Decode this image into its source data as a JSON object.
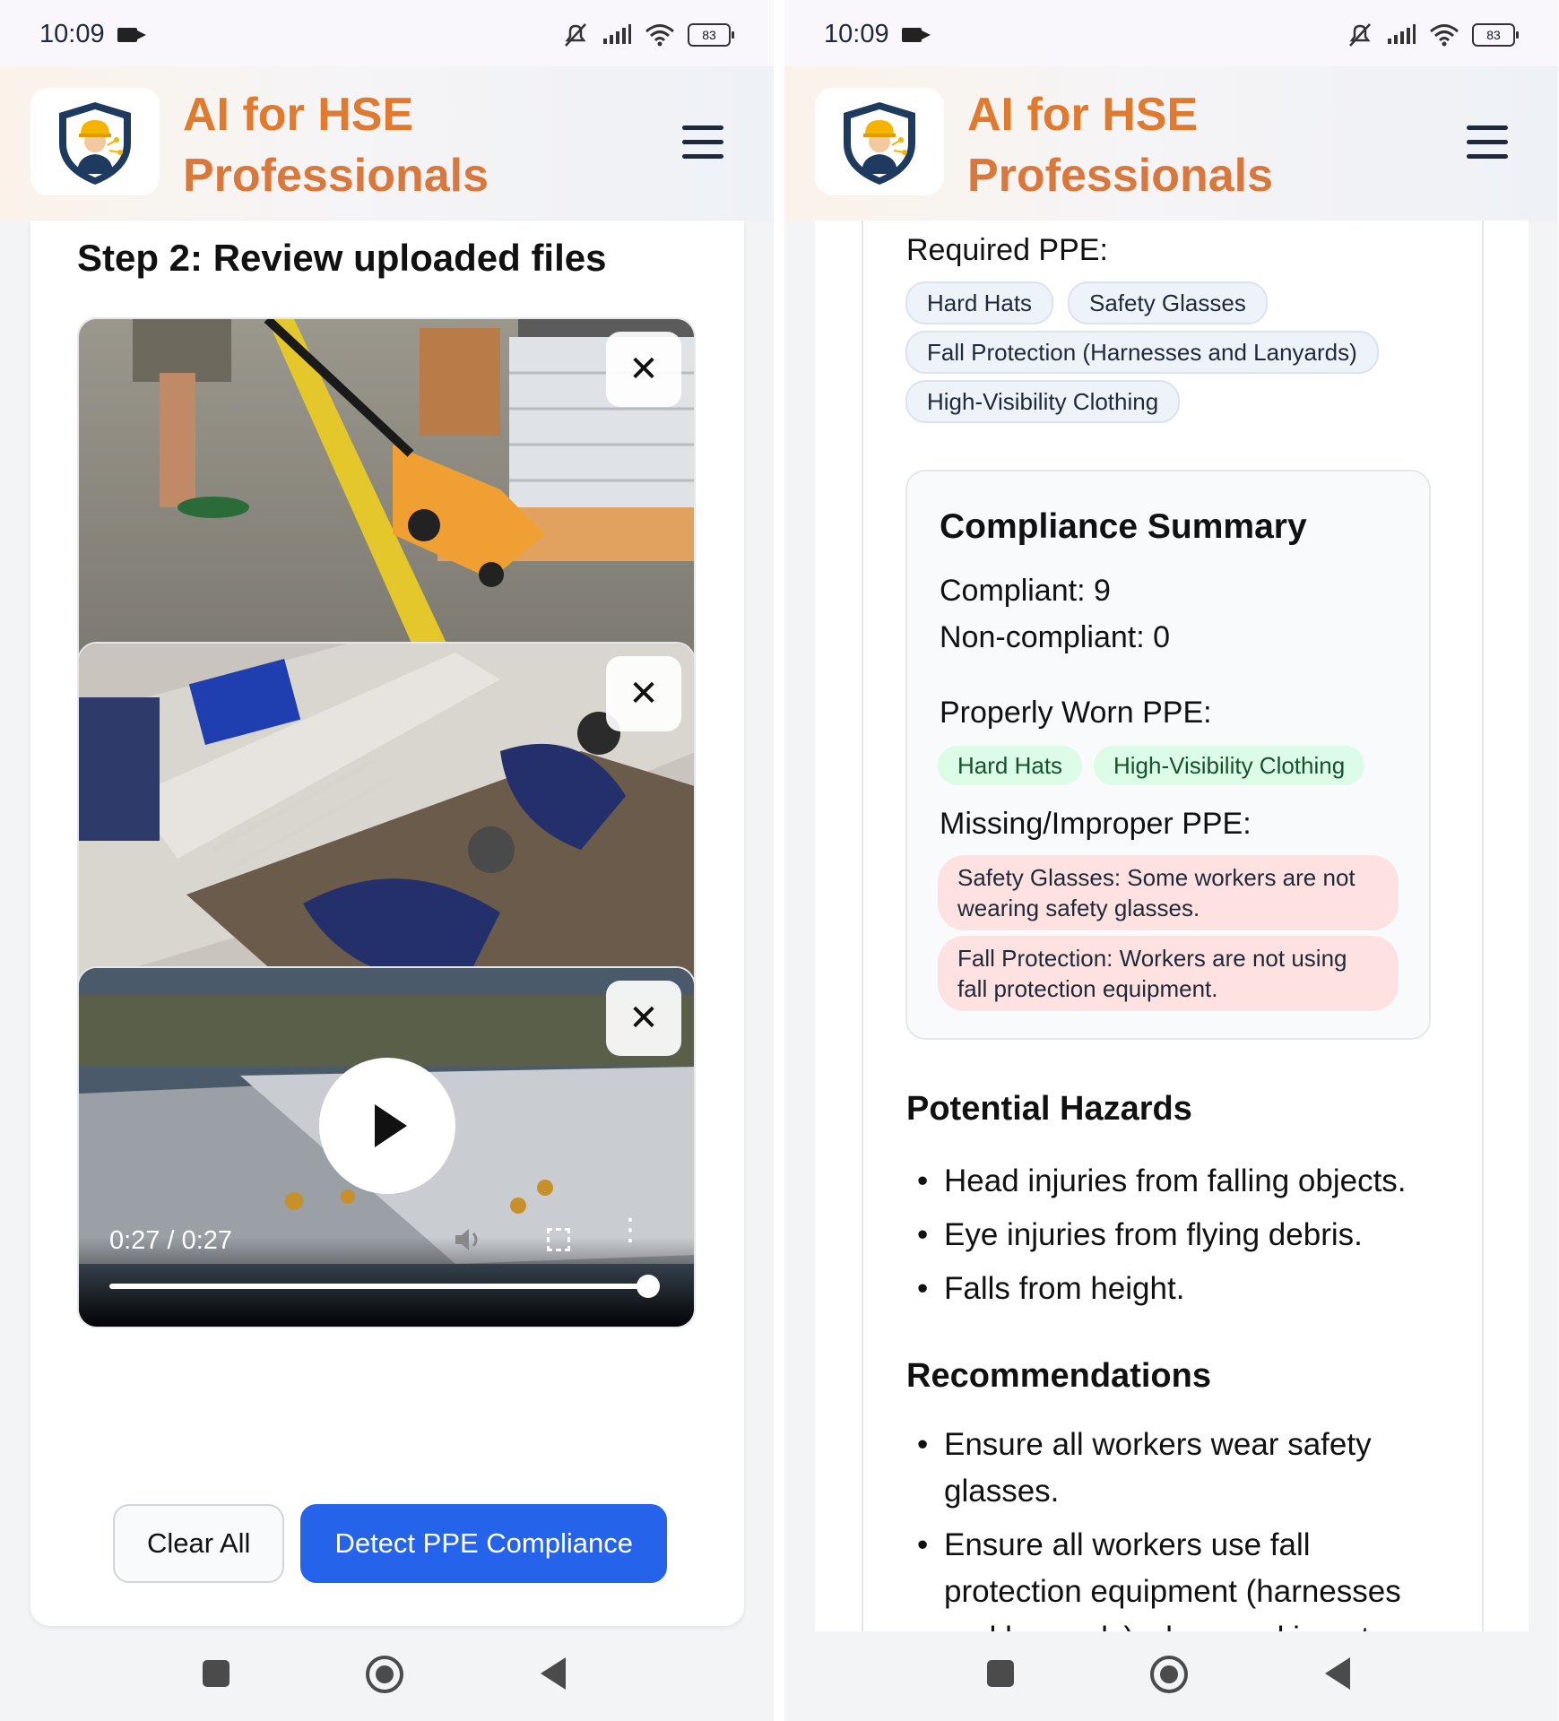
{
  "status_bar": {
    "time": "10:09",
    "battery": "83"
  },
  "app": {
    "title_line1": "AI for HSE",
    "title_line2": "Professionals",
    "logo_icon": "shield-worker-icon",
    "menu_icon": "hamburger-menu-icon"
  },
  "left_screen": {
    "step_title": "Step 2: Review uploaded files",
    "files": [
      {
        "type": "image",
        "description_icon": "pallet-jack-image",
        "close_label": "✕"
      },
      {
        "type": "image",
        "description_icon": "workers-drilling-image",
        "close_label": "✕"
      },
      {
        "type": "video",
        "close_label": "✕",
        "time_display": "0:27 / 0:27",
        "progress": 1.0
      }
    ],
    "clear_button": "Clear All",
    "detect_button": "Detect PPE Compliance"
  },
  "right_screen": {
    "required_label": "Required PPE:",
    "required_ppe": [
      "Hard Hats",
      "Safety Glasses",
      "Fall Protection (Harnesses and Lanyards)",
      "High-Visibility Clothing"
    ],
    "summary": {
      "title": "Compliance Summary",
      "compliant": "Compliant: 9",
      "non_compliant": "Non-compliant: 0",
      "properly_worn_label": "Properly Worn PPE:",
      "properly_worn": [
        "Hard Hats",
        "High-Visibility Clothing"
      ],
      "missing_label": "Missing/Improper PPE:",
      "missing": [
        "Safety Glasses: Some workers are not wearing safety glasses.",
        "Fall Protection: Workers are not using fall protection equipment."
      ]
    },
    "hazards_title": "Potential Hazards",
    "hazards": [
      "Head injuries from falling objects.",
      "Eye injuries from flying debris.",
      "Falls from height."
    ],
    "recommendations_title": "Recommendations",
    "recommendations": [
      "Ensure all workers wear safety glasses.",
      "Ensure all workers use fall protection equipment (harnesses and lanyards) when working at"
    ]
  },
  "colors": {
    "accent_orange": "#e07a2e",
    "primary_blue": "#2563eb",
    "chip_green": "#dcfce7",
    "chip_red": "#fee2e2"
  }
}
